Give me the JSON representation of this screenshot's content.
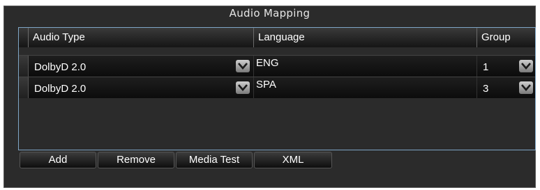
{
  "window": {
    "title": "Audio Mapping"
  },
  "table": {
    "columns": [
      "Audio Type",
      "Language",
      "Group"
    ],
    "rows": [
      {
        "audio_type": "DolbyD 2.0",
        "language": "ENG",
        "group": "1"
      },
      {
        "audio_type": "DolbyD 2.0",
        "language": "SPA",
        "group": "3"
      }
    ]
  },
  "buttons": {
    "add": "Add",
    "remove": "Remove",
    "media_test": "Media Test",
    "xml": "XML"
  },
  "icons": {
    "dropdown": "chevron-down-icon"
  }
}
